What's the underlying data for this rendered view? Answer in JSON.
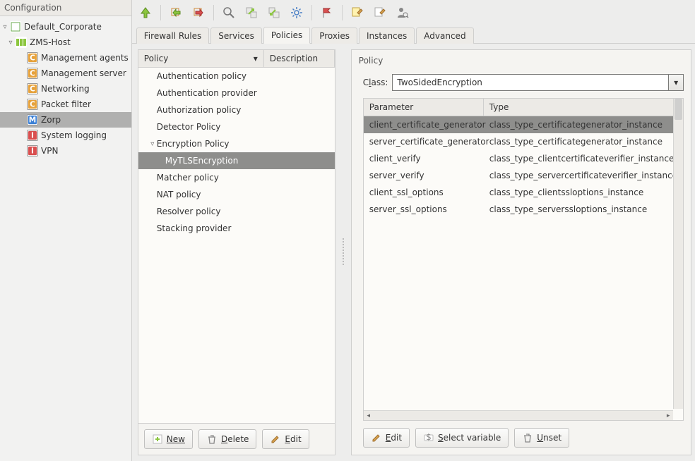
{
  "sidebar": {
    "title": "Configuration",
    "tree": {
      "site": "Default_Corporate",
      "host": "ZMS-Host",
      "items": [
        {
          "icon": "c",
          "label": "Management agents"
        },
        {
          "icon": "c",
          "label": "Management server"
        },
        {
          "icon": "c",
          "label": "Networking"
        },
        {
          "icon": "c",
          "label": "Packet filter"
        },
        {
          "icon": "m",
          "label": "Zorp",
          "selected": true
        },
        {
          "icon": "i",
          "label": "System logging"
        },
        {
          "icon": "i",
          "label": "VPN"
        }
      ]
    }
  },
  "tabs": [
    "Firewall Rules",
    "Services",
    "Policies",
    "Proxies",
    "Instances",
    "Advanced"
  ],
  "active_tab": "Policies",
  "policies_panel": {
    "columns": [
      "Policy",
      "Description"
    ],
    "items": [
      {
        "label": "Authentication policy"
      },
      {
        "label": "Authentication provider"
      },
      {
        "label": "Authorization policy"
      },
      {
        "label": "Detector Policy"
      },
      {
        "label": "Encryption Policy",
        "expanded": true,
        "children": [
          {
            "label": "MyTLSEncryption",
            "selected": true
          }
        ]
      },
      {
        "label": "Matcher policy"
      },
      {
        "label": "NAT policy"
      },
      {
        "label": "Resolver policy"
      },
      {
        "label": "Stacking provider"
      }
    ],
    "buttons": {
      "new": "New",
      "delete": "Delete",
      "edit": "Edit"
    }
  },
  "policy_detail": {
    "title": "Policy",
    "class_label": "Class:",
    "class_value": "TwoSidedEncryption",
    "columns": [
      "Parameter",
      "Type"
    ],
    "rows": [
      {
        "p": "client_certificate_generator",
        "t": "class_type_certificategenerator_instance",
        "selected": true
      },
      {
        "p": "server_certificate_generator",
        "t": "class_type_certificategenerator_instance"
      },
      {
        "p": "client_verify",
        "t": "class_type_clientcertificateverifier_instance"
      },
      {
        "p": "server_verify",
        "t": "class_type_servercertificateverifier_instance"
      },
      {
        "p": "client_ssl_options",
        "t": "class_type_clientssloptions_instance"
      },
      {
        "p": "server_ssl_options",
        "t": "class_type_serverssloptions_instance"
      }
    ],
    "buttons": {
      "edit": "Edit",
      "select_var": "Select variable",
      "unset": "Unset"
    }
  }
}
